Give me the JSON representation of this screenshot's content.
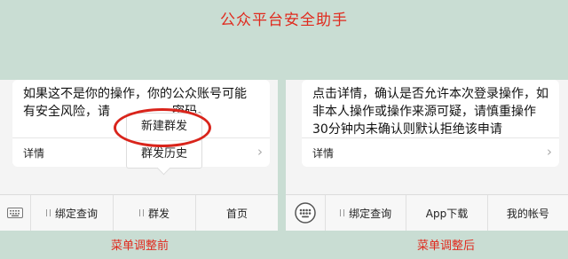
{
  "title": "公众平台安全助手",
  "left": {
    "message_line1": "如果这不是你的操作，你的公众账号可能",
    "message_line2": "有安全风险，请",
    "message_line2_tail": "密码。",
    "detail_label": "详情",
    "popup_items": [
      "新建群发",
      "群发历史"
    ],
    "menu_items": [
      "绑定查询",
      "群发",
      "首页"
    ],
    "caption": "菜单调整前"
  },
  "right": {
    "message_lines": [
      "点击详情，确认是否允许本次登录操作，如",
      "非本人操作或操作来源可疑，请慎重操作",
      "30分钟内未确认则默认拒绝该申请"
    ],
    "detail_label": "详情",
    "menu_items": [
      "绑定查询",
      "App下载",
      "我的帐号"
    ],
    "caption": "菜单调整后"
  },
  "colors": {
    "background": "#c9ddd3",
    "highlight": "#e02a1e",
    "circle": "#d9241b"
  },
  "icons": {
    "keyboard": "keyboard-icon",
    "chevron": "chevron-right-icon"
  }
}
